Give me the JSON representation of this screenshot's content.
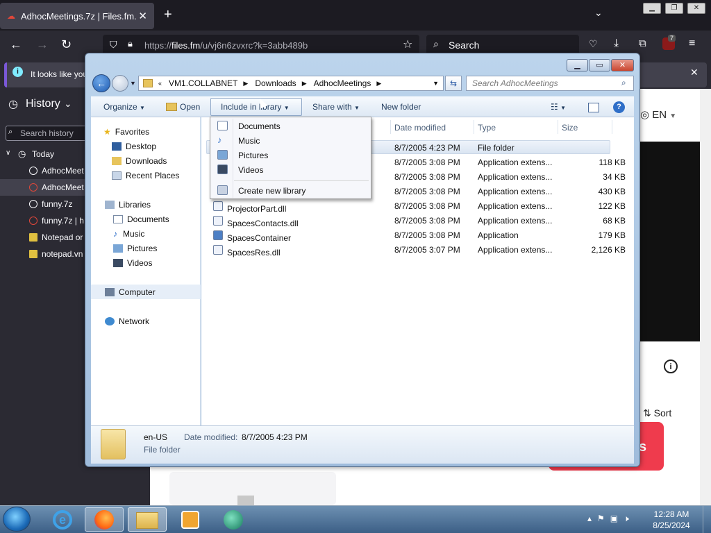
{
  "browser": {
    "tab_title": "AdhocMeetings.7z | Files.fm.",
    "tab_close": "✕",
    "new_tab": "+",
    "url_prefix": "https://",
    "url_domain": "files.fm",
    "url_path": "/u/vj6n6zvxrc?k=3abb489b",
    "search_label": "Search",
    "extension_badge": "7",
    "notice_text": "It looks like you"
  },
  "sidebar": {
    "title": "History",
    "search_placeholder": "Search history",
    "group": "Today",
    "items": [
      {
        "label": "AdhocMeet",
        "icon": "globe-icon"
      },
      {
        "label": "AdhocMeet",
        "icon": "cloud-icon"
      },
      {
        "label": "funny.7z",
        "icon": "globe-icon"
      },
      {
        "label": "funny.7z | h",
        "icon": "cloud-icon"
      },
      {
        "label": "Notepad or",
        "icon": "note-icon"
      },
      {
        "label": "notepad.vn",
        "icon": "note-icon"
      }
    ]
  },
  "page": {
    "lang": "EN",
    "sort": "Sort",
    "red_button_suffix": "s"
  },
  "explorer": {
    "breadcrumb": [
      "VM1.COLLABNET",
      "Downloads",
      "AdhocMeetings"
    ],
    "search_placeholder": "Search AdhocMeetings",
    "toolbar": {
      "organize": "Organize",
      "open": "Open",
      "include": "Include in library",
      "share": "Share with",
      "new_folder": "New folder"
    },
    "nav": {
      "favorites": "Favorites",
      "fav_items": [
        "Desktop",
        "Downloads",
        "Recent Places"
      ],
      "libraries": "Libraries",
      "lib_items": [
        "Documents",
        "Music",
        "Pictures",
        "Videos"
      ],
      "computer": "Computer",
      "network": "Network"
    },
    "columns": {
      "date": "Date modified",
      "type": "Type",
      "size": "Size"
    },
    "files": [
      {
        "name": "",
        "date": "8/7/2005 4:23 PM",
        "type": "File folder",
        "size": ""
      },
      {
        "name": "",
        "date": "8/7/2005 3:08 PM",
        "type": "Application extens...",
        "size": "118 KB"
      },
      {
        "name": "",
        "date": "8/7/2005 3:08 PM",
        "type": "Application extens...",
        "size": "34 KB"
      },
      {
        "name": "",
        "date": "8/7/2005 3:08 PM",
        "type": "Application extens...",
        "size": "430 KB"
      },
      {
        "name": "ProjectorPart.dll",
        "date": "8/7/2005 3:08 PM",
        "type": "Application extens...",
        "size": "122 KB"
      },
      {
        "name": "SpacesContacts.dll",
        "date": "8/7/2005 3:08 PM",
        "type": "Application extens...",
        "size": "68 KB"
      },
      {
        "name": "SpacesContainer",
        "date": "8/7/2005 3:08 PM",
        "type": "Application",
        "size": "179 KB"
      },
      {
        "name": "SpacesRes.dll",
        "date": "8/7/2005 3:07 PM",
        "type": "Application extens...",
        "size": "2,126 KB"
      }
    ],
    "details": {
      "name": "en-US",
      "date_label": "Date modified:",
      "date_value": "8/7/2005 4:23 PM",
      "kind": "File folder"
    },
    "menu": {
      "items": [
        "Documents",
        "Music",
        "Pictures",
        "Videos"
      ],
      "create": "Create new library"
    }
  },
  "taskbar": {
    "time": "12:28 AM",
    "date": "8/25/2024"
  }
}
